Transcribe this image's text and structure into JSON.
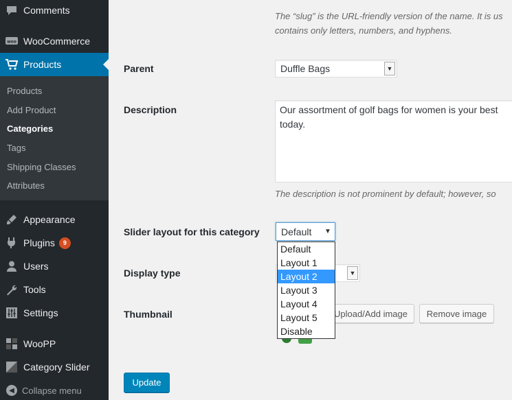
{
  "sidebar": {
    "comments": "Comments",
    "woocommerce": "WooCommerce",
    "products": "Products",
    "submenu": [
      "Products",
      "Add Product",
      "Categories",
      "Tags",
      "Shipping Classes",
      "Attributes"
    ],
    "appearance": "Appearance",
    "plugins": "Plugins",
    "plugins_badge": "9",
    "users": "Users",
    "tools": "Tools",
    "settings": "Settings",
    "woopp": "WooPP",
    "category_slider": "Category Slider",
    "collapse": "Collapse menu"
  },
  "form": {
    "slug_note_line1": "The “slug” is the URL-friendly version of the name. It is us",
    "slug_note_line2": "contains only letters, numbers, and hyphens.",
    "parent_label": "Parent",
    "parent_value": "Duffle Bags",
    "description_label": "Description",
    "description_line1": "Our assortment of golf bags for women is your best",
    "description_line2": "today.",
    "description_note": "The description is not prominent by default; however, so",
    "slider_label": "Slider layout for this category",
    "slider_value": "Default",
    "slider_options": [
      "Default",
      "Layout 1",
      "Layout 2",
      "Layout 3",
      "Layout 4",
      "Layout 5",
      "Disable"
    ],
    "slider_highlighted": "Layout 2",
    "display_type_label": "Display type",
    "thumbnail_label": "Thumbnail",
    "upload_button": "Upload/Add image",
    "remove_button": "Remove image",
    "update_button": "Update"
  },
  "colors": {
    "sidebar_bg": "#23282d",
    "active_bg": "#0073aa",
    "primary_button": "#0085ba",
    "highlight": "#3399ff",
    "badge": "#d54e21"
  }
}
